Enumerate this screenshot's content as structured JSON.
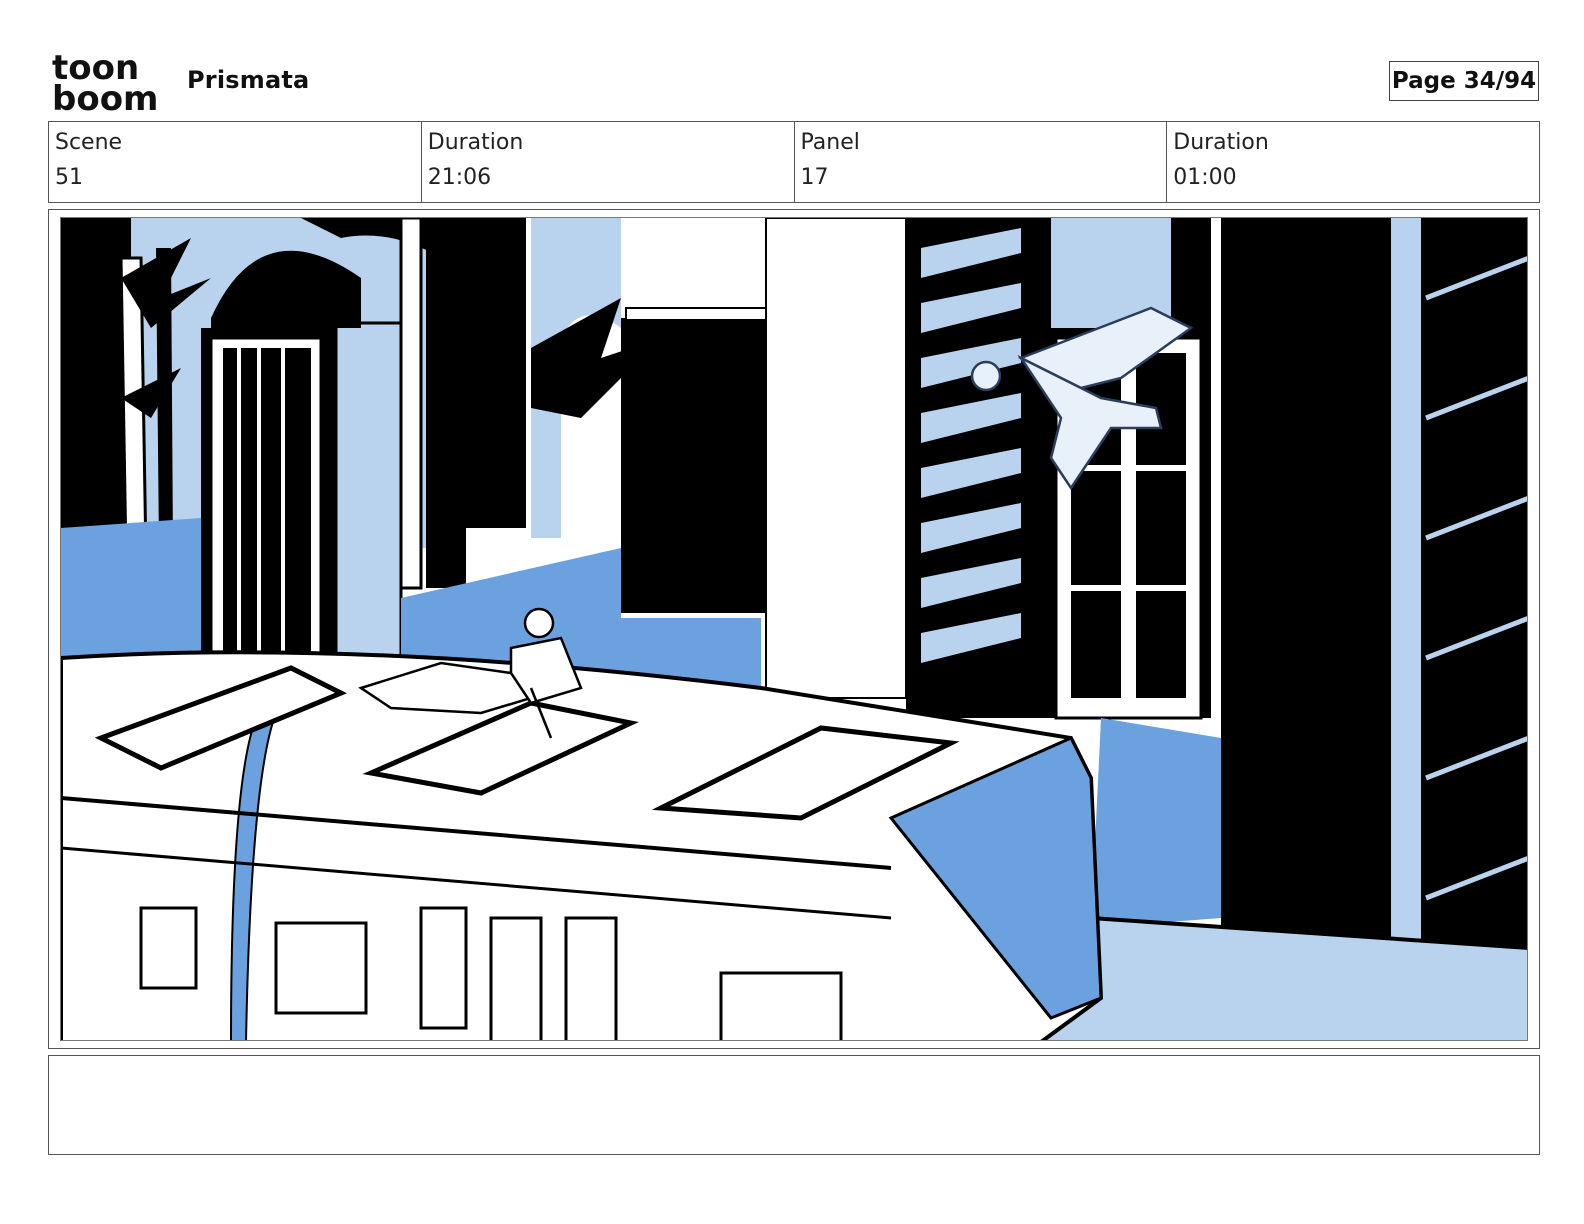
{
  "header": {
    "logo_text_top": "toon",
    "logo_text_bottom": "boom",
    "project_title": "Prismata",
    "page_counter": "Page 34/94"
  },
  "info": {
    "scene_label": "Scene",
    "scene_value": "51",
    "scene_duration_label": "Duration",
    "scene_duration_value": "21:06",
    "panel_label": "Panel",
    "panel_value": "17",
    "panel_duration_label": "Duration",
    "panel_duration_value": "01:00"
  },
  "panel": {
    "colors": {
      "black": "#000000",
      "light_blue": "#b9d3ee",
      "mid_blue": "#6aa1de",
      "white": "#ffffff"
    }
  },
  "notes": {
    "text": ""
  }
}
